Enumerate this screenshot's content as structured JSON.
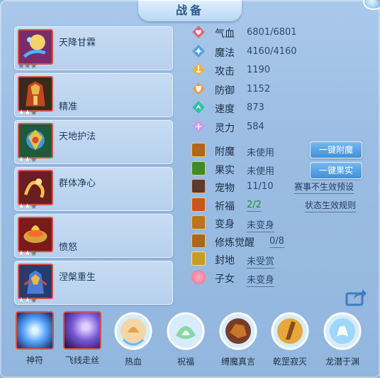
{
  "window": {
    "title": "战备"
  },
  "skills": [
    {
      "name": "天降甘霖",
      "stars": 0,
      "max_stars": 3,
      "icon": "rain-spell-icon"
    },
    {
      "name": "精准",
      "stars": 2,
      "max_stars": 3,
      "icon": "precision-armor-icon"
    },
    {
      "name": "天地护法",
      "stars": 2,
      "max_stars": 3,
      "icon": "guardian-icon"
    },
    {
      "name": "群体净心",
      "stars": 2,
      "max_stars": 3,
      "icon": "dragon-cleanse-icon"
    },
    {
      "name": "愤怒",
      "stars": 2,
      "max_stars": 3,
      "icon": "fury-bowl-icon"
    },
    {
      "name": "涅槃重生",
      "stars": 2,
      "max_stars": 3,
      "icon": "rebirth-icon"
    }
  ],
  "attributes": [
    {
      "label": "气血",
      "value": "6801/6801",
      "color": "#e8647a"
    },
    {
      "label": "魔法",
      "value": "4160/4160",
      "color": "#4f9ee0"
    },
    {
      "label": "攻击",
      "value": "1190",
      "color": "#f0b23c"
    },
    {
      "label": "防御",
      "value": "1152",
      "color": "#e89a55"
    },
    {
      "label": "速度",
      "value": "873",
      "color": "#2fc2a2"
    },
    {
      "label": "灵力",
      "value": "584",
      "color": "#c79ae6"
    }
  ],
  "status": {
    "enchant": {
      "label": "附魔",
      "value": "未使用",
      "button": "一键附魔"
    },
    "fruit": {
      "label": "果实",
      "value": "未使用",
      "button": "一键果实"
    },
    "pet": {
      "label": "宠物",
      "value": "11/10",
      "link": "赛事不生效预设"
    },
    "blessing": {
      "label": "祈福",
      "value": "2/2",
      "link": "状态生效规则"
    },
    "transform": {
      "label": "变身",
      "value": "未变身"
    },
    "cultivate": {
      "label": "修炼觉醒",
      "value": "0/8"
    },
    "fief": {
      "label": "封地",
      "value": "未受赏"
    },
    "child": {
      "label": "子女",
      "value": "未变身"
    }
  },
  "bottom_items": [
    {
      "label": "神符",
      "icon": "divine-rune-icon",
      "framed": true
    },
    {
      "label": "飞线走丝",
      "icon": "flying-thread-icon",
      "framed": true
    },
    {
      "label": "热血",
      "icon": "hot-blood-icon",
      "framed": false
    },
    {
      "label": "祝福",
      "icon": "blessing-icon",
      "framed": false
    },
    {
      "label": "缚魔真言",
      "icon": "bind-demon-icon",
      "framed": false
    },
    {
      "label": "乾罡寂灭",
      "icon": "qiangang-icon",
      "framed": false
    },
    {
      "label": "龙潜于渊",
      "icon": "hidden-dragon-icon",
      "framed": false
    }
  ]
}
